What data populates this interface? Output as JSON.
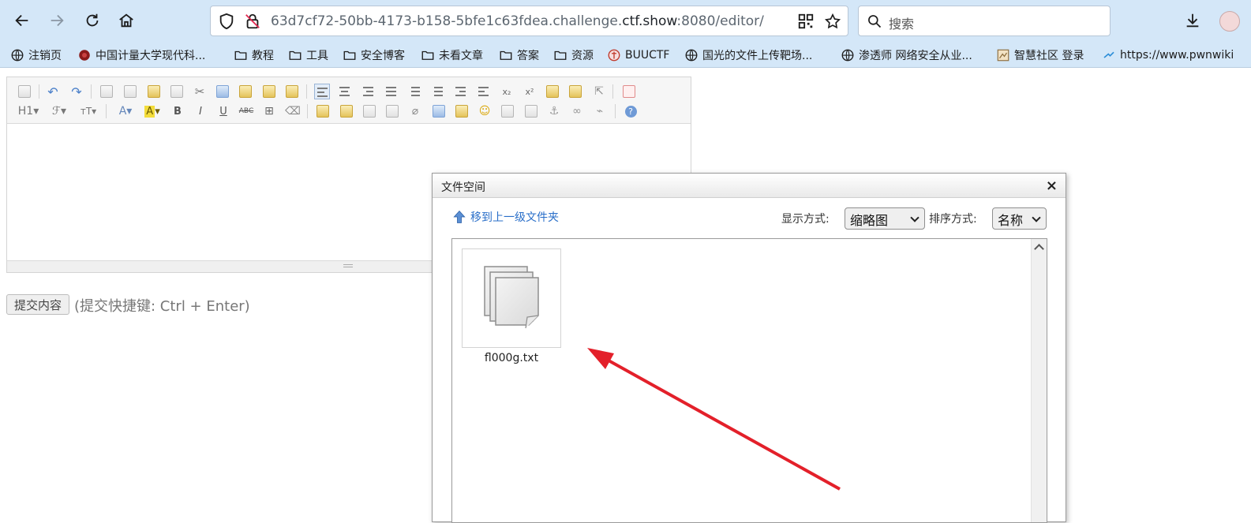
{
  "browser": {
    "url_prefix": "63d7cf72-50bb-4173-b158-5bfe1c63fdea.challenge.",
    "url_host": "ctf.show",
    "url_suffix": ":8080/editor/",
    "search_placeholder": "搜索",
    "bookmarks": [
      {
        "label": "注销页",
        "icon": "globe-icon"
      },
      {
        "label": "中国计量大学现代科...",
        "icon": "site-logo-icon"
      },
      {
        "label": "教程",
        "icon": "folder-icon"
      },
      {
        "label": "工具",
        "icon": "folder-icon"
      },
      {
        "label": "安全博客",
        "icon": "folder-icon"
      },
      {
        "label": "未看文章",
        "icon": "folder-icon"
      },
      {
        "label": "答案",
        "icon": "folder-icon"
      },
      {
        "label": "资源",
        "icon": "folder-icon"
      },
      {
        "label": "BUUCTF",
        "icon": "buuctf-logo-icon"
      },
      {
        "label": "国光的文件上传靶场...",
        "icon": "globe-icon"
      },
      {
        "label": "渗透师 网络安全从业...",
        "icon": "globe-icon"
      },
      {
        "label": "智慧社区 登录",
        "icon": "site-logo-icon"
      },
      {
        "label": "https://www.pwnwiki",
        "icon": "site-logo-icon"
      }
    ]
  },
  "editor": {
    "heading_label": "H1",
    "submit_label": "提交内容",
    "submit_hint": "(提交快捷键: Ctrl + Enter)"
  },
  "dialog": {
    "title": "文件空间",
    "close_glyph": "×",
    "up_folder_label": "移到上一级文件夹",
    "view_label": "显示方式:",
    "view_value": "缩略图",
    "sort_label": "排序方式:",
    "sort_value": "名称",
    "files": [
      {
        "name": "fl000g.txt",
        "icon": "document-stack-icon"
      }
    ]
  },
  "annotation": {
    "arrow_color": "#e3202a"
  }
}
